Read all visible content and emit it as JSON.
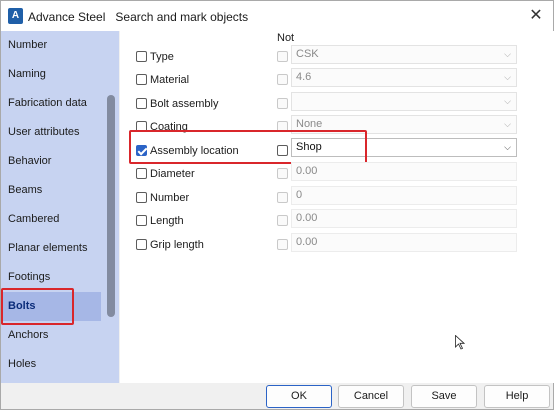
{
  "window": {
    "app_name": "Advance Steel",
    "title": "Search and mark objects",
    "icon_letter": "A"
  },
  "sidebar": {
    "items": [
      {
        "label": "Number"
      },
      {
        "label": "Naming"
      },
      {
        "label": "Fabrication data"
      },
      {
        "label": "User attributes"
      },
      {
        "label": "Behavior"
      },
      {
        "label": "Beams"
      },
      {
        "label": "Cambered"
      },
      {
        "label": "Planar elements"
      },
      {
        "label": "Footings"
      },
      {
        "label": "Bolts",
        "selected": true
      },
      {
        "label": "Anchors"
      },
      {
        "label": "Holes"
      }
    ]
  },
  "main": {
    "not_header": "Not",
    "rows": [
      {
        "label": "Type",
        "checked": false,
        "not_checked": false,
        "value": "CSK",
        "dropdown": true
      },
      {
        "label": "Material",
        "checked": false,
        "not_checked": false,
        "value": "4.6",
        "dropdown": true
      },
      {
        "label": "Bolt assembly",
        "checked": false,
        "not_checked": false,
        "value": "",
        "dropdown": true
      },
      {
        "label": "Coating",
        "checked": false,
        "not_checked": false,
        "value": "None",
        "dropdown": true
      },
      {
        "label": "Assembly location",
        "checked": true,
        "not_checked": false,
        "value": "Shop",
        "dropdown": true,
        "active": true
      },
      {
        "label": "Diameter",
        "checked": false,
        "not_checked": false,
        "value": "0.00",
        "dropdown": false
      },
      {
        "label": "Number",
        "checked": false,
        "not_checked": false,
        "value": "0",
        "dropdown": false
      },
      {
        "label": "Length",
        "checked": false,
        "not_checked": false,
        "value": "0.00",
        "dropdown": false
      },
      {
        "label": "Grip length",
        "checked": false,
        "not_checked": false,
        "value": "0.00",
        "dropdown": false
      }
    ]
  },
  "buttons": {
    "ok": "OK",
    "cancel": "Cancel",
    "save": "Save",
    "help": "Help"
  },
  "colors": {
    "sidebar_bg": "#c7d3f1",
    "selected_bg": "#a6b7e6",
    "highlight": "#d9262b",
    "accent": "#2b63c6"
  }
}
